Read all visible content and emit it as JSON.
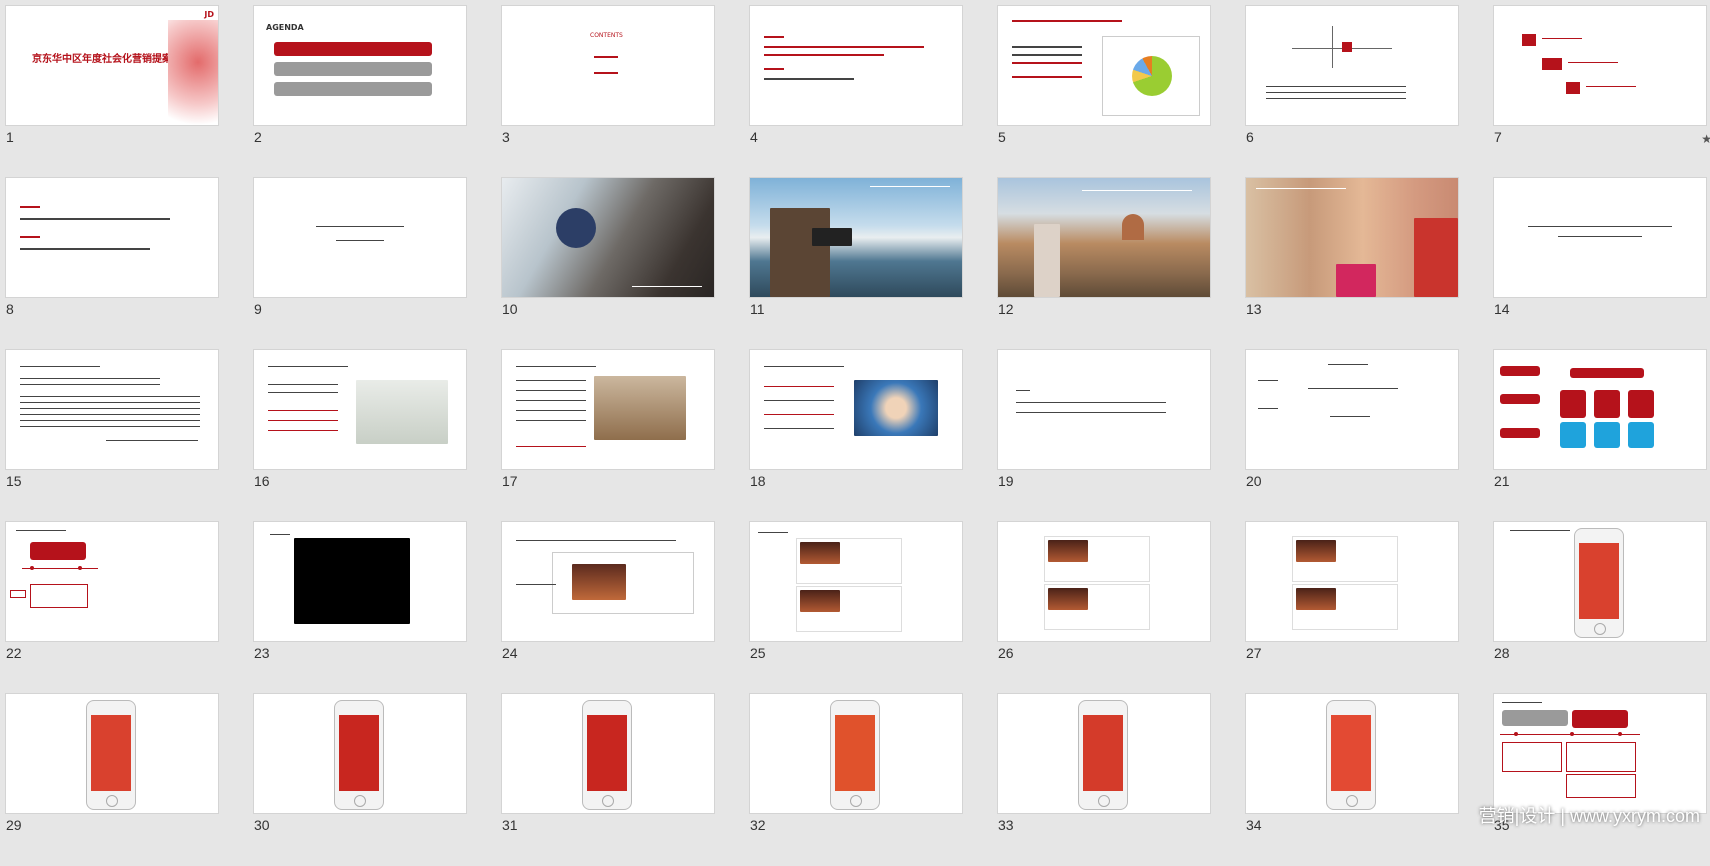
{
  "slides": [
    {
      "n": "1",
      "title": "京东华中区年度社会化营销提案"
    },
    {
      "n": "2",
      "agenda": "AGENDA"
    },
    {
      "n": "3",
      "contents": "CONTENTS"
    },
    {
      "n": "4"
    },
    {
      "n": "5"
    },
    {
      "n": "6"
    },
    {
      "n": "7",
      "starred": "★"
    },
    {
      "n": "8"
    },
    {
      "n": "9"
    },
    {
      "n": "10"
    },
    {
      "n": "11"
    },
    {
      "n": "12"
    },
    {
      "n": "13"
    },
    {
      "n": "14"
    },
    {
      "n": "15"
    },
    {
      "n": "16"
    },
    {
      "n": "17"
    },
    {
      "n": "18"
    },
    {
      "n": "19"
    },
    {
      "n": "20"
    },
    {
      "n": "21"
    },
    {
      "n": "22"
    },
    {
      "n": "23"
    },
    {
      "n": "24"
    },
    {
      "n": "25"
    },
    {
      "n": "26"
    },
    {
      "n": "27"
    },
    {
      "n": "28"
    },
    {
      "n": "29"
    },
    {
      "n": "30"
    },
    {
      "n": "31"
    },
    {
      "n": "32"
    },
    {
      "n": "33"
    },
    {
      "n": "34"
    },
    {
      "n": "35"
    }
  ],
  "logo_text": "JD",
  "watermark": "营销|设计 | www.yxrym.com",
  "colors": {
    "accent": "#b5121b",
    "background": "#e6e6e6"
  }
}
